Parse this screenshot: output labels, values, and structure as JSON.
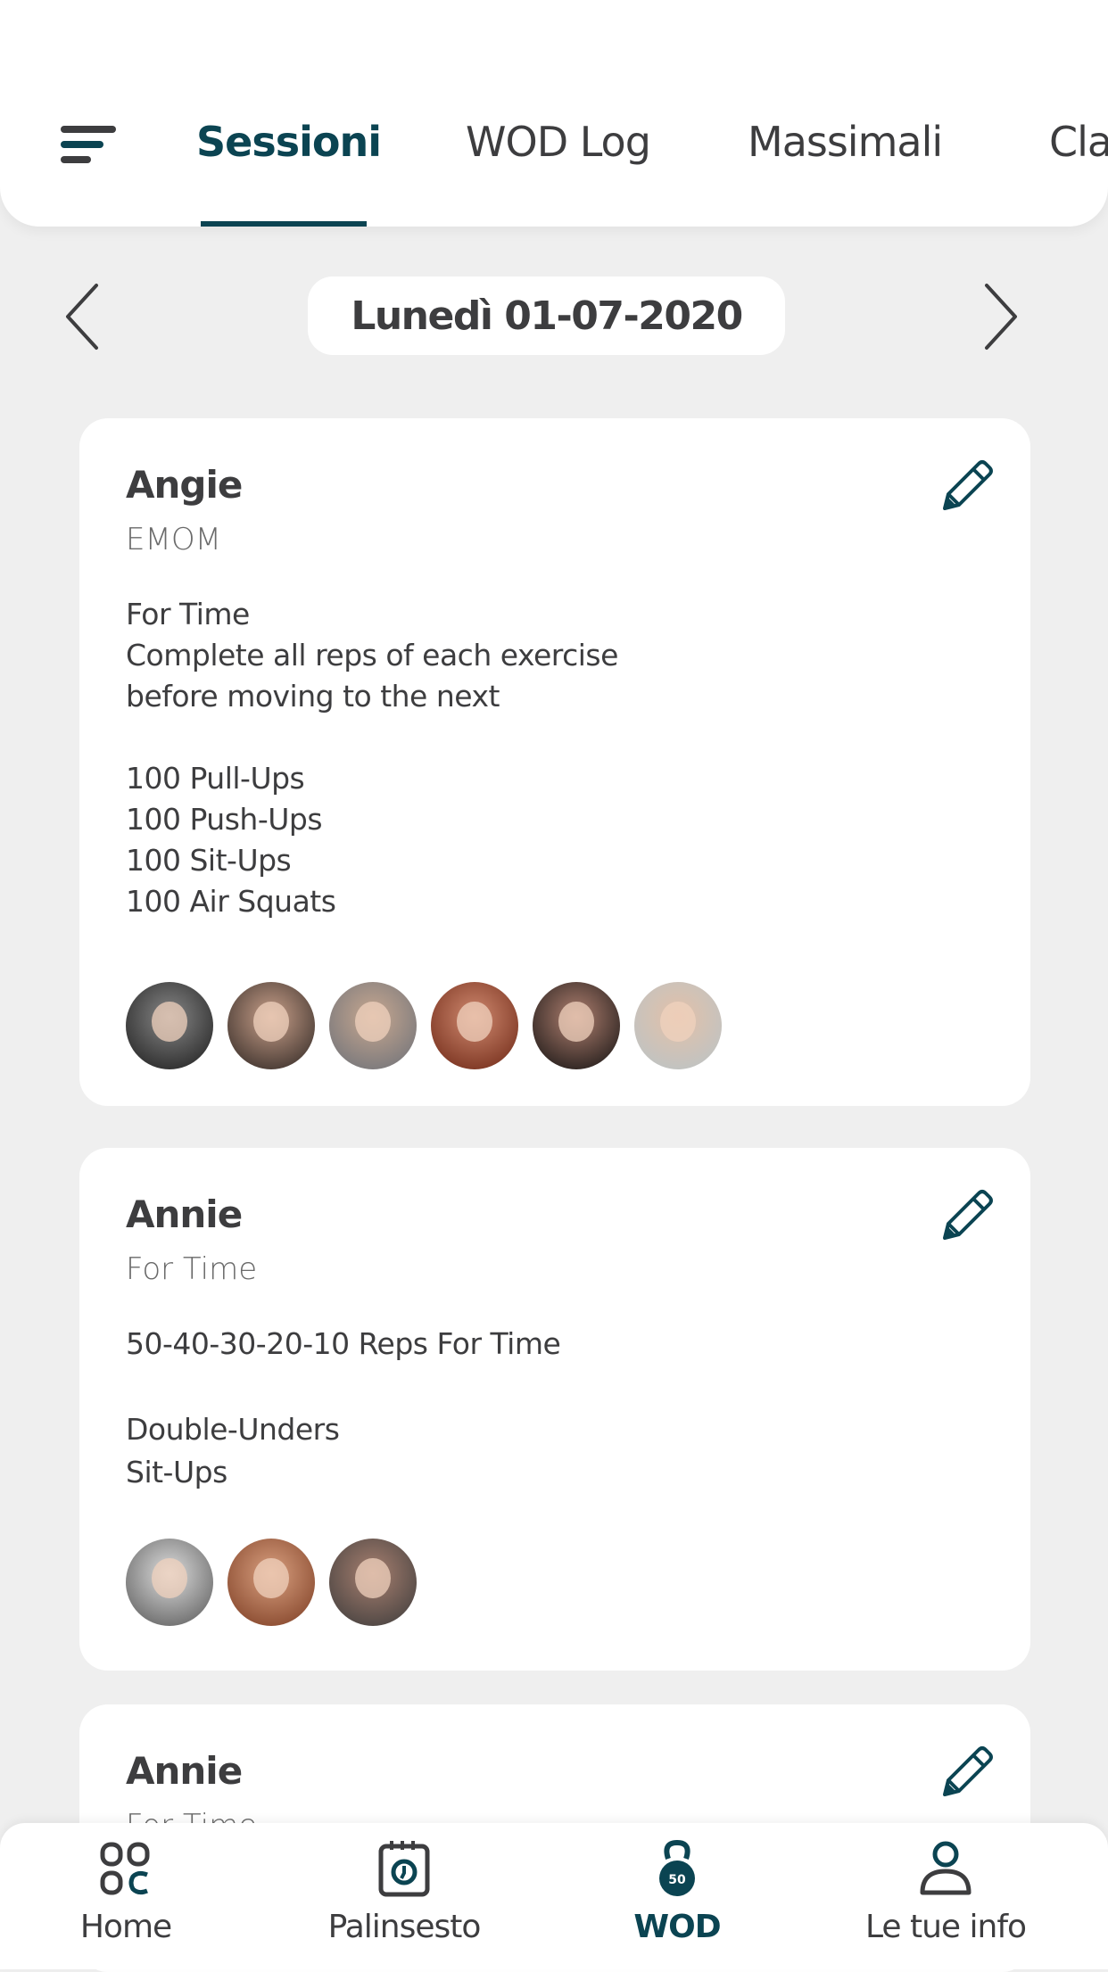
{
  "header": {
    "menu_icon": "hamburger-icon",
    "tabs": [
      {
        "label": "Sessioni",
        "active": true
      },
      {
        "label": "WOD Log"
      },
      {
        "label": "Massimali"
      },
      {
        "label": "Cla"
      }
    ]
  },
  "date_nav": {
    "label": "Lunedì 01-07-2020",
    "prev_icon": "chevron-left-icon",
    "next_icon": "chevron-right-icon"
  },
  "accent": "#0b4452",
  "cards": [
    {
      "title": "Angie",
      "type": "EMOM",
      "lines": [
        "For Time",
        "Complete all reps of each exercise",
        "before moving to the next",
        "",
        "100 Pull-Ups",
        "100 Push-Ups",
        "100 Sit-Ups",
        "100 Air Squats"
      ],
      "participants": 6
    },
    {
      "title": "Annie",
      "type": "For Time",
      "lines": [
        "50-40-30-20-10 Reps For Time",
        "",
        "Double-Unders",
        "Sit-Ups"
      ],
      "participants": 3
    },
    {
      "title": "Annie",
      "type": "For Time"
    }
  ],
  "bottom_nav": [
    {
      "label": "Home",
      "icon": "grid-icon"
    },
    {
      "label": "Palinsesto",
      "icon": "calendar-clock-icon"
    },
    {
      "label": "WOD",
      "icon": "kettlebell-icon",
      "badge": "50",
      "active": true
    },
    {
      "label": "Le tue info",
      "icon": "user-icon"
    }
  ]
}
